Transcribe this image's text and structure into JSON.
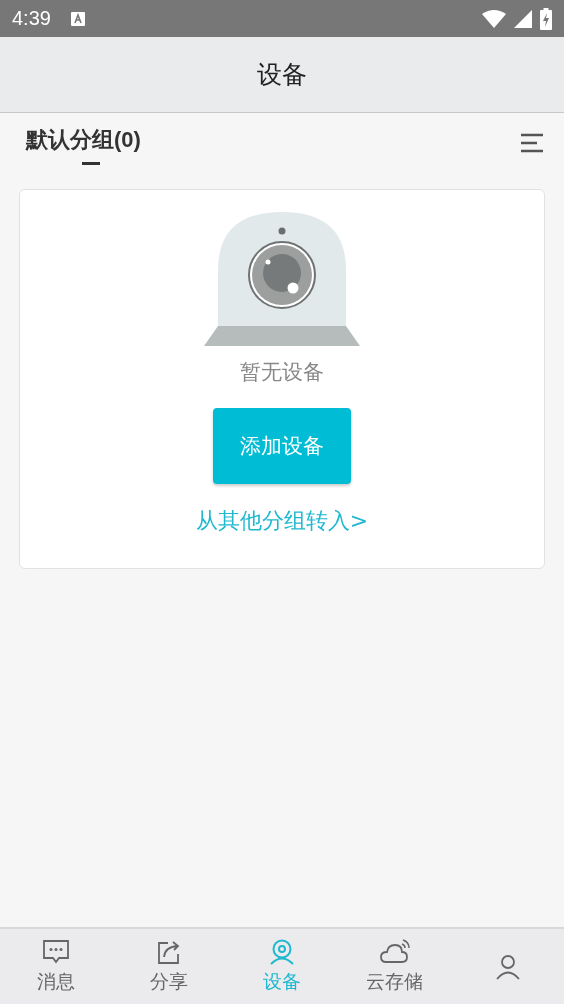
{
  "status_bar": {
    "time": "4:39"
  },
  "header": {
    "title": "设备"
  },
  "group_tab": {
    "label": "默认分组(0)",
    "selected": true
  },
  "empty_state": {
    "message": "暂无设备",
    "add_button": "添加设备",
    "transfer_link": "从其他分组转入>"
  },
  "bottom_nav": [
    {
      "kind": "message",
      "label": "消息",
      "selected": false
    },
    {
      "kind": "share",
      "label": "分享",
      "selected": false
    },
    {
      "kind": "device",
      "label": "设备",
      "selected": true
    },
    {
      "kind": "cloud",
      "label": "云存储",
      "selected": false
    },
    {
      "kind": "person",
      "selected": false
    }
  ]
}
